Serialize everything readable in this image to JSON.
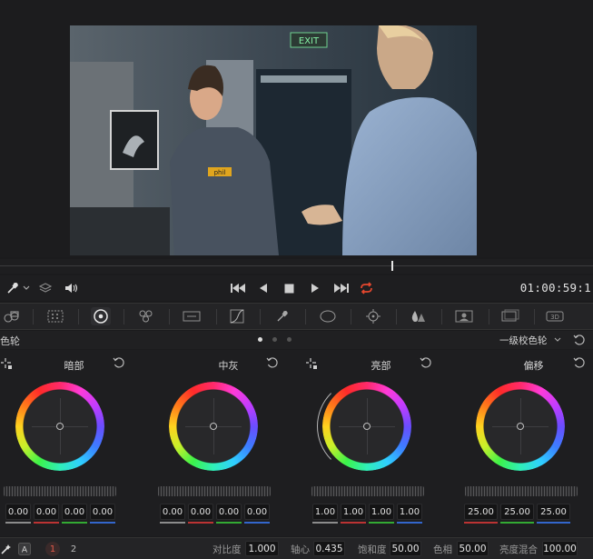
{
  "viewer": {
    "exit_sign_text": "EXIT",
    "badge_text": "phil"
  },
  "transport": {
    "timecode": "01:00:59:1"
  },
  "panel": {
    "title": "色轮",
    "mode_select": "一级校色轮"
  },
  "wheels": [
    {
      "title": "暗部",
      "values": [
        "0.00",
        "0.00",
        "0.00",
        "0.00"
      ]
    },
    {
      "title": "中灰",
      "values": [
        "0.00",
        "0.00",
        "0.00",
        "0.00"
      ]
    },
    {
      "title": "亮部",
      "values": [
        "1.00",
        "1.00",
        "1.00",
        "1.00"
      ]
    },
    {
      "title": "偏移",
      "values": [
        "25.00",
        "25.00",
        "25.00"
      ]
    }
  ],
  "footer": {
    "page_1": "1",
    "page_2": "2",
    "contrast_label": "对比度",
    "contrast_value": "1.000",
    "pivot_label": "轴心",
    "pivot_value": "0.435",
    "saturation_label": "饱和度",
    "saturation_value": "50.00",
    "hue_label": "色相",
    "hue_value": "50.00",
    "lum_mix_label": "亮度混合",
    "lum_mix_value": "100.00"
  },
  "icons": [
    "eyedropper-icon",
    "chevron-down-icon",
    "layers-icon",
    "speaker-icon",
    "skip-back-icon",
    "play-reverse-icon",
    "stop-icon",
    "play-icon",
    "skip-forward-icon",
    "loop-icon",
    "reset-icon"
  ]
}
